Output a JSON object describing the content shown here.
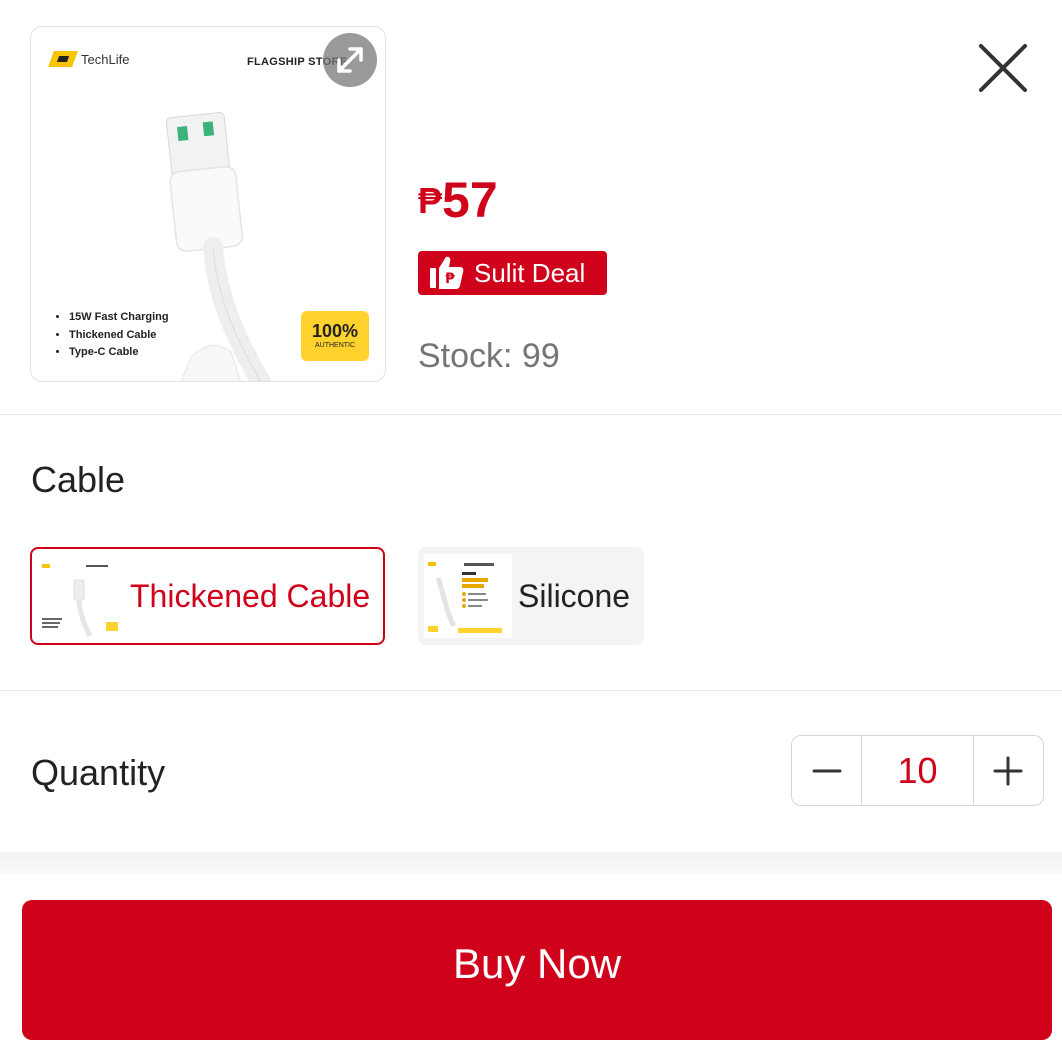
{
  "product": {
    "image": {
      "brand": "TechLife",
      "store_label": "FLAGSHIP STORE",
      "features": [
        "15W Fast Charging",
        "Thickened Cable",
        "Type-C Cable"
      ],
      "badge_main": "100%",
      "badge_sub": "AUTHENTIC"
    },
    "currency": "₱",
    "price": "57",
    "deal_label": "Sulit Deal",
    "stock_text": "Stock: 99"
  },
  "variant_section": {
    "title": "Cable",
    "options": [
      {
        "label": "Thickened Cable",
        "selected": true
      },
      {
        "label": "Silicone",
        "selected": false
      }
    ]
  },
  "quantity_section": {
    "title": "Quantity",
    "value": "10",
    "decrement_icon": "minus-icon",
    "increment_icon": "plus-icon"
  },
  "buy_button": {
    "label": "Buy Now"
  },
  "colors": {
    "accent": "#d0011b",
    "muted_text": "#757575",
    "badge_yellow": "#ffd22e"
  }
}
